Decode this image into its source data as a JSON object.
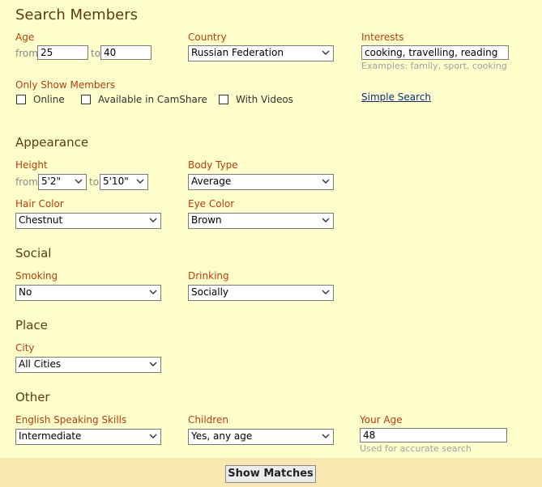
{
  "page": {
    "title": "Search Members"
  },
  "basic": {
    "age_label": "Age",
    "age_from_text": "from",
    "age_from_value": "25",
    "age_to_text": "to",
    "age_to_value": "40",
    "country_label": "Country",
    "country_value": "Russian Federation",
    "interests_label": "Interests",
    "interests_value": "cooking, travelling, reading",
    "interests_hint": "Examples: family, sport, cooking",
    "only_show_label": "Only Show Members",
    "options": [
      {
        "label": "Online",
        "checked": false
      },
      {
        "label": "Available in CamShare",
        "checked": false
      },
      {
        "label": "With Videos",
        "checked": false
      }
    ],
    "simple_search_link": "Simple Search"
  },
  "appearance": {
    "heading": "Appearance",
    "height_label": "Height",
    "height_from_text": "from",
    "height_from_value": "5'2\"",
    "height_to_text": "to",
    "height_to_value": "5'10\"",
    "body_type_label": "Body Type",
    "body_type_value": "Average",
    "hair_color_label": "Hair Color",
    "hair_color_value": "Chestnut",
    "eye_color_label": "Eye Color",
    "eye_color_value": "Brown"
  },
  "social": {
    "heading": "Social",
    "smoking_label": "Smoking",
    "smoking_value": "No",
    "drinking_label": "Drinking",
    "drinking_value": "Socially"
  },
  "place": {
    "heading": "Place",
    "city_label": "City",
    "city_value": "All Cities"
  },
  "other": {
    "heading": "Other",
    "english_label": "English Speaking Skills",
    "english_value": "Intermediate",
    "children_label": "Children",
    "children_value": "Yes, any age",
    "your_age_label": "Your Age",
    "your_age_value": "48",
    "your_age_hint": "Used for accurate search"
  },
  "footer": {
    "show_matches_label": "Show Matches"
  },
  "icons": {
    "select_arrow": "chevron-down-icon"
  },
  "colors": {
    "background": "#ffffcc",
    "footer": "#f9e8b0",
    "heading": "#5a3b12",
    "label": "#c0390b",
    "link": "#0a2d84"
  }
}
